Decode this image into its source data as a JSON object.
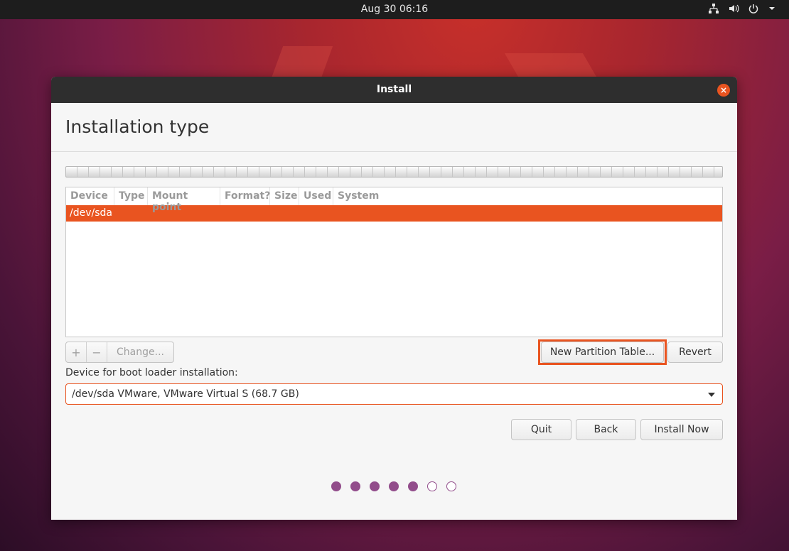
{
  "topbar": {
    "datetime": "Aug 30  06:16",
    "tray_icons": [
      "network-icon",
      "volume-icon",
      "power-icon",
      "menu-arrow-icon"
    ]
  },
  "window": {
    "title": "Install",
    "close_icon": "close-icon"
  },
  "page": {
    "title": "Installation type"
  },
  "partition_table": {
    "columns": [
      "Device",
      "Type",
      "Mount point",
      "Format?",
      "Size",
      "Used",
      "System"
    ],
    "rows": [
      {
        "device": "/dev/sda",
        "selected": true
      }
    ]
  },
  "partition_buttons": {
    "add": "+",
    "remove": "−",
    "change": "Change...",
    "new_partition_table": "New Partition Table...",
    "revert": "Revert"
  },
  "boot_loader": {
    "label": "Device for boot loader installation:",
    "selected": "/dev/sda VMware, VMware Virtual S (68.7 GB)"
  },
  "nav_buttons": {
    "quit": "Quit",
    "back": "Back",
    "install_now": "Install Now"
  },
  "progress": {
    "completed_steps": 5,
    "total_steps": 7
  },
  "colors": {
    "accent": "#e95420",
    "progress_dot": "#924d8b"
  }
}
